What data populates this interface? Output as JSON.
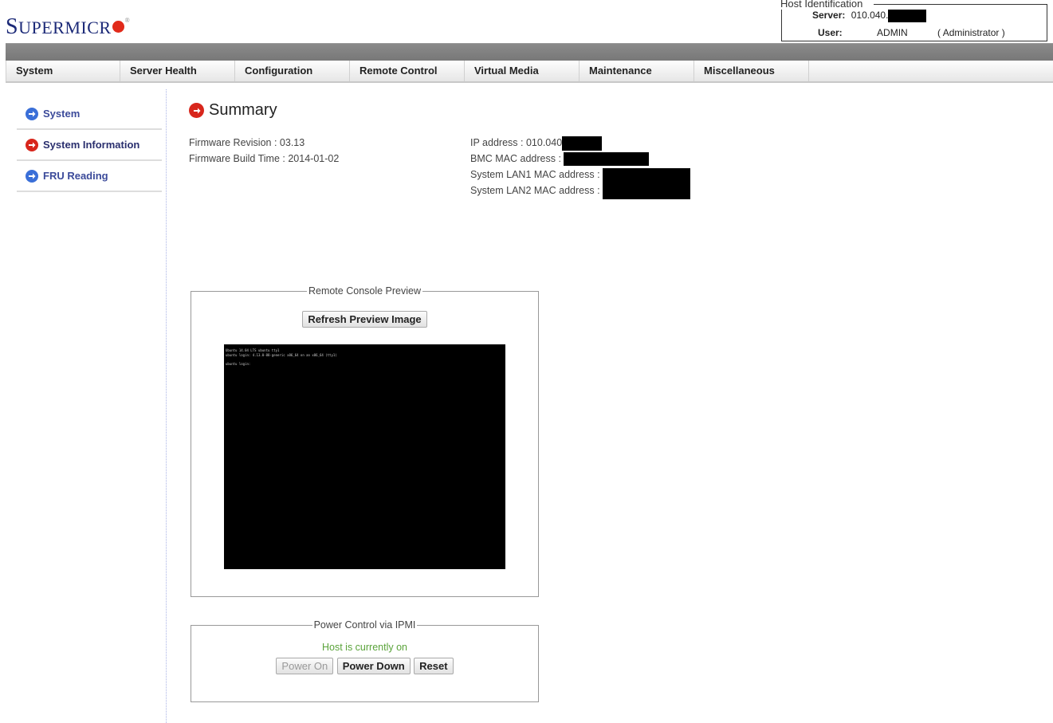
{
  "brand": {
    "logo_first": "S",
    "logo_rest": "UPERMICR",
    "logo_reg": "®"
  },
  "host": {
    "legend": "Host Identification",
    "server_label": "Server:",
    "server_value": "010.040.",
    "user_label": "User:",
    "user_value": "ADMIN",
    "user_role": "( Administrator )"
  },
  "menu": [
    "System",
    "Server Health",
    "Configuration",
    "Remote Control",
    "Virtual Media",
    "Maintenance",
    "Miscellaneous"
  ],
  "sidebar": [
    {
      "label": "System",
      "icon": "arrow-circle-blue-icon",
      "active": false
    },
    {
      "label": "System Information",
      "icon": "arrow-circle-red-icon",
      "active": true
    },
    {
      "label": "FRU Reading",
      "icon": "arrow-circle-blue-icon",
      "active": false
    }
  ],
  "page": {
    "title": "Summary"
  },
  "firmware": {
    "revision_label": "Firmware Revision :",
    "revision_value": "03.13",
    "build_label": "Firmware Build Time :",
    "build_value": "2014-01-02"
  },
  "network": {
    "ip_label": "IP address :",
    "ip_value": "010.040",
    "bmc_mac_label": "BMC MAC address :",
    "lan1_label": "System LAN1 MAC address :",
    "lan2_label": "System LAN2 MAC address :"
  },
  "console": {
    "legend": "Remote Console Preview",
    "refresh_label": "Refresh Preview Image",
    "lines": [
      "Ubuntu 14.04 LTS ubuntu tty1",
      "ubuntu login: 4.13.0-88-generic x86_64 on an x86_64 (tty1)",
      "ubuntu login:"
    ]
  },
  "power": {
    "legend": "Power Control via IPMI",
    "status": "Host is currently on",
    "power_on_label": "Power On",
    "power_down_label": "Power Down",
    "reset_label": "Reset"
  },
  "colors": {
    "brand_blue": "#1c2a78",
    "brand_red": "#e12a1a",
    "status_green": "#5aa33a"
  }
}
